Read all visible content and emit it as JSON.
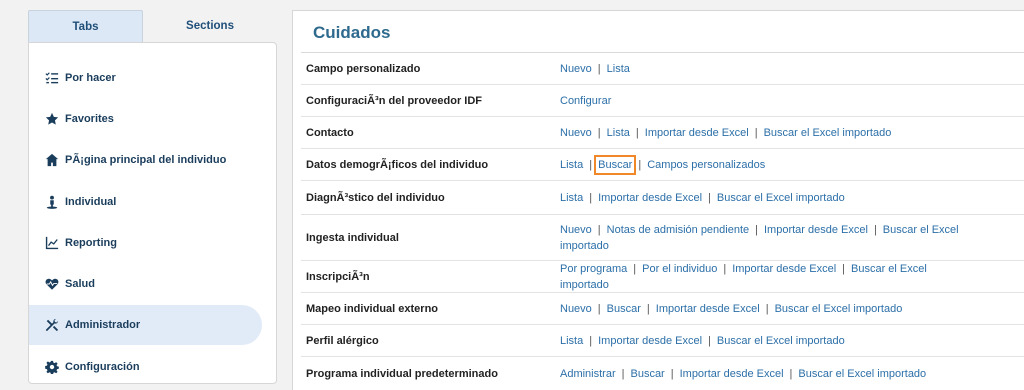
{
  "tabs": [
    {
      "label": "Tabs"
    },
    {
      "label": "Sections"
    }
  ],
  "menu": [
    {
      "label": "Por hacer",
      "icon": "checklist-icon"
    },
    {
      "label": "Favorites",
      "icon": "star-icon"
    },
    {
      "label": "PÃ¡gina principal del individuo",
      "icon": "home-icon"
    },
    {
      "label": "Individual",
      "icon": "person-icon"
    },
    {
      "label": "Reporting",
      "icon": "chart-icon"
    },
    {
      "label": "Salud",
      "icon": "heart-pulse-icon"
    },
    {
      "label": "Administrador",
      "icon": "tools-icon",
      "active": true
    },
    {
      "label": "Configuración",
      "icon": "gear-icon"
    }
  ],
  "page": {
    "title": "Cuidados"
  },
  "rows": [
    {
      "label": "Campo personalizado",
      "links": [
        "Nuevo",
        "Lista"
      ]
    },
    {
      "label": "ConfiguraciÃ³n del proveedor IDF",
      "links": [
        "Configurar"
      ]
    },
    {
      "label": "Contacto",
      "links": [
        "Nuevo",
        "Lista",
        "Importar desde Excel",
        "Buscar el Excel importado"
      ]
    },
    {
      "label": "Datos demogrÃ¡ficos del individuo",
      "links": [
        "Lista",
        "Buscar",
        "Campos personalizados"
      ],
      "highlight": 1
    },
    {
      "label": "DiagnÃ³stico del individuo",
      "links": [
        "Lista",
        "Importar desde Excel",
        "Buscar el Excel importado"
      ]
    },
    {
      "label": "Ingesta individual",
      "links": [
        "Nuevo",
        "Notas de admisión pendiente",
        "Importar desde Excel",
        "Buscar el Excel importado"
      ]
    },
    {
      "label": "InscripciÃ³n",
      "links": [
        "Por programa",
        "Por el individuo",
        "Importar desde Excel",
        "Buscar el Excel importado"
      ]
    },
    {
      "label": "Mapeo individual externo",
      "links": [
        "Nuevo",
        "Buscar",
        "Importar desde Excel",
        "Buscar el Excel importado"
      ]
    },
    {
      "label": "Perfil alérgico",
      "links": [
        "Lista",
        "Importar desde Excel",
        "Buscar el Excel importado"
      ]
    },
    {
      "label": "Programa individual predeterminado",
      "links": [
        "Administrar",
        "Buscar",
        "Importar desde Excel",
        "Buscar el Excel importado"
      ]
    }
  ],
  "colors": {
    "accent": "#2c6fa8",
    "title": "#2e6a8e",
    "highlight": "#f0882a",
    "active_bg": "#e1ebf8"
  }
}
